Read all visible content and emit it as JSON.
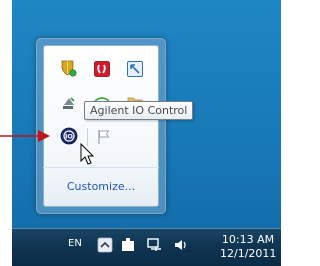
{
  "tray_popup": {
    "tooltip": "Agilent IO Control",
    "customize_label": "Customize...",
    "icons": [
      "shield-notify-icon",
      "red-app-icon",
      "network-box-icon",
      "eject-usb-icon",
      "wireless-icon",
      "folder-icon",
      "agilent-io-icon",
      "flag-icon"
    ]
  },
  "taskbar": {
    "language": "EN",
    "time": "10:13 AM",
    "date": "12/1/2011"
  },
  "annotation": {
    "arrow_color": "#c0131b"
  }
}
